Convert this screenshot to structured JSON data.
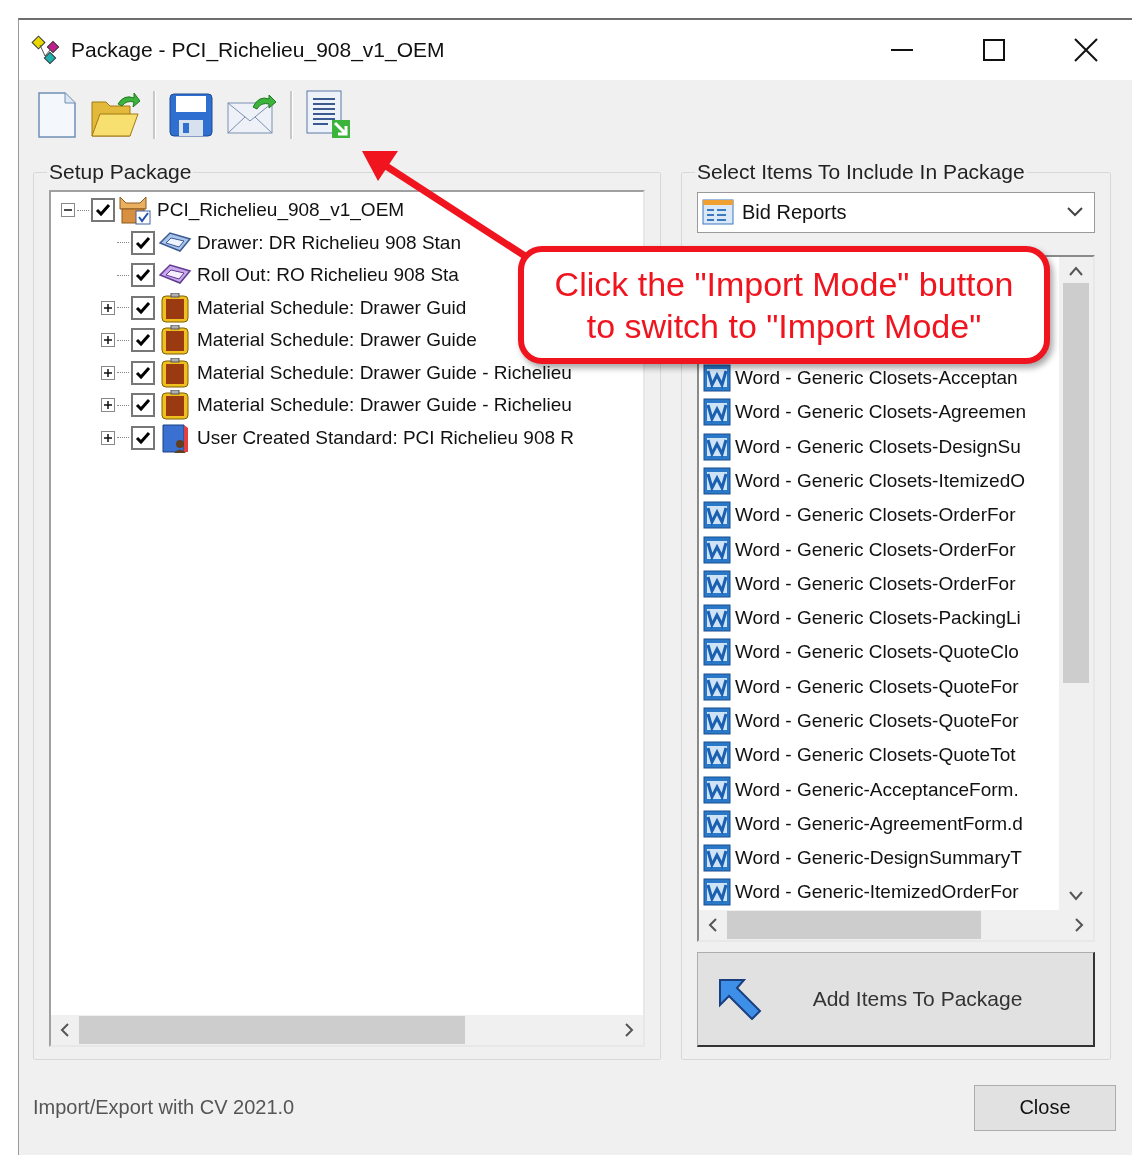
{
  "window": {
    "title": "Package - PCI_Richelieu_908_v1_OEM"
  },
  "setup_package": {
    "legend": "Setup Package",
    "tree": [
      {
        "label": "PCI_Richelieu_908_v1_OEM",
        "kind": "package",
        "checked": true,
        "expanded": true,
        "children": [
          {
            "label": "Drawer: DR Richelieu 908 Stan",
            "kind": "drawer",
            "checked": true
          },
          {
            "label": "Roll Out: RO Richelieu 908 Sta",
            "kind": "rollout",
            "checked": true
          },
          {
            "label": "Material Schedule: Drawer Guid",
            "kind": "material",
            "checked": true,
            "expanded": false
          },
          {
            "label": "Material Schedule: Drawer Guide",
            "kind": "material",
            "checked": true,
            "expanded": false
          },
          {
            "label": "Material Schedule: Drawer Guide - Richelieu",
            "kind": "material",
            "checked": true,
            "expanded": false
          },
          {
            "label": "Material Schedule: Drawer Guide - Richelieu",
            "kind": "material",
            "checked": true,
            "expanded": false
          },
          {
            "label": "User Created Standard: PCI Richelieu 908 R",
            "kind": "standard",
            "checked": true,
            "expanded": false
          }
        ]
      }
    ]
  },
  "select_items": {
    "legend": "Select Items To Include In Package",
    "dropdown": {
      "value": "Bid Reports"
    },
    "items": [
      {
        "label": "Word - Generic Closets-Acceptan"
      },
      {
        "label": "Word - Generic Closets-Agreemen"
      },
      {
        "label": "Word - Generic Closets-DesignSu"
      },
      {
        "label": "Word - Generic Closets-ItemizedO"
      },
      {
        "label": "Word - Generic Closets-OrderFor"
      },
      {
        "label": "Word - Generic Closets-OrderFor"
      },
      {
        "label": "Word - Generic Closets-OrderFor"
      },
      {
        "label": "Word - Generic Closets-PackingLi"
      },
      {
        "label": "Word - Generic Closets-QuoteClo"
      },
      {
        "label": "Word - Generic Closets-QuoteFor"
      },
      {
        "label": "Word - Generic Closets-QuoteFor"
      },
      {
        "label": "Word - Generic Closets-QuoteTot"
      },
      {
        "label": "Word - Generic-AcceptanceForm."
      },
      {
        "label": "Word - Generic-AgreementForm.d"
      },
      {
        "label": "Word - Generic-DesignSummaryT"
      },
      {
        "label": "Word - Generic-ItemizedOrderFor"
      }
    ],
    "add_button": "Add Items To Package"
  },
  "status_text": "Import/Export with CV 2021.0",
  "close_button": "Close",
  "callout": {
    "lines": [
      "Click the \"Import Mode\" button",
      "to switch to \"Import Mode\""
    ]
  }
}
